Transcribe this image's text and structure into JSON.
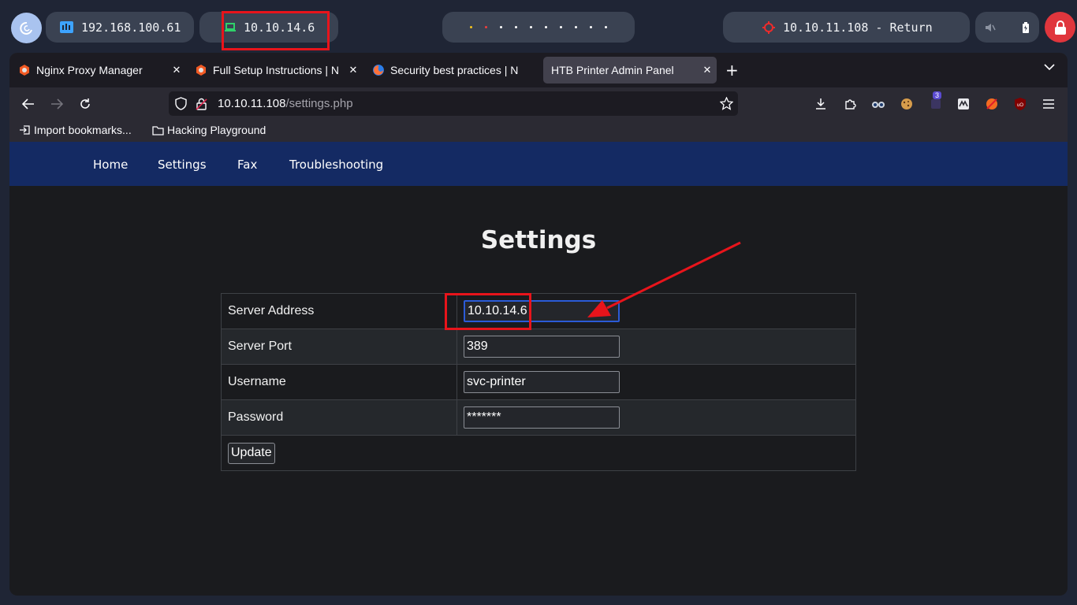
{
  "panel": {
    "network_ip": "192.168.100.61",
    "vpn_ip": "10.10.14.6",
    "target_label": "10.10.11.108 - Return",
    "accent_red": "#e8141b"
  },
  "browser": {
    "tabs": [
      {
        "title": "Nginx Proxy Manager",
        "icon": "nginx-proxy-icon"
      },
      {
        "title": "Full Setup Instructions | N",
        "icon": "nginx-proxy-icon"
      },
      {
        "title": "Security best practices | N",
        "icon": "firefox-icon"
      },
      {
        "title": "HTB Printer Admin Panel",
        "icon": "none"
      }
    ],
    "url_host": "10.10.11.108",
    "url_path": "/settings.php",
    "extension_badge": "3",
    "bookmarks": [
      {
        "label": "Import bookmarks...",
        "icon": "import-icon"
      },
      {
        "label": "Hacking Playground",
        "icon": "folder-icon"
      }
    ]
  },
  "site": {
    "nav": [
      "Home",
      "Settings",
      "Fax",
      "Troubleshooting"
    ],
    "nav_color": "#142a63",
    "title": "Settings",
    "form": {
      "server_address": {
        "label": "Server Address",
        "value": "10.10.14.6"
      },
      "server_port": {
        "label": "Server Port",
        "value": "389"
      },
      "username": {
        "label": "Username",
        "value": "svc-printer"
      },
      "password": {
        "label": "Password",
        "value": "*******"
      },
      "submit_label": "Update"
    }
  }
}
